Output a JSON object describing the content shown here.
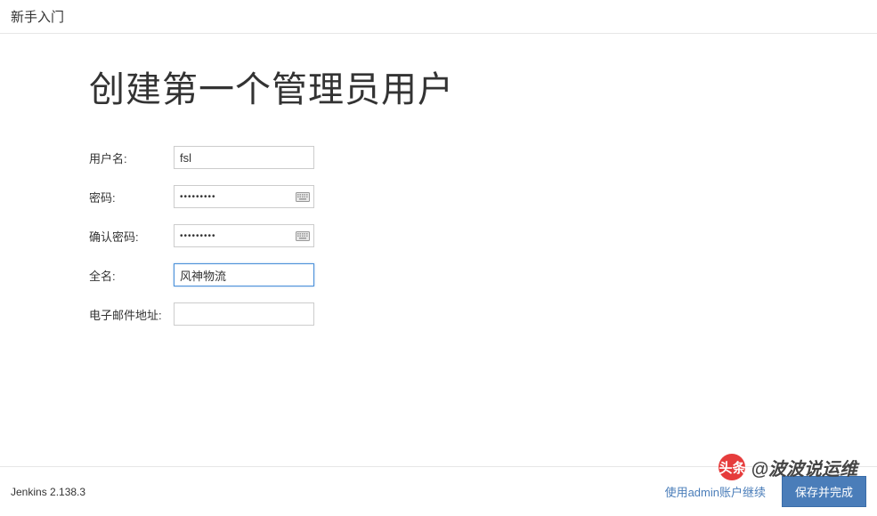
{
  "header": {
    "breadcrumb": "新手入门"
  },
  "main": {
    "title": "创建第一个管理员用户",
    "form": {
      "username": {
        "label": "用户名:",
        "value": "fsl"
      },
      "password": {
        "label": "密码:",
        "value": "•••••••••"
      },
      "confirm_password": {
        "label": "确认密码:",
        "value": "•••••••••"
      },
      "fullname": {
        "label": "全名:",
        "value": "风神物流"
      },
      "email": {
        "label": "电子邮件地址:",
        "value": ""
      }
    }
  },
  "footer": {
    "version": "Jenkins 2.138.3",
    "skip_label": "使用admin账户继续",
    "save_label": "保存并完成"
  },
  "watermark": {
    "prefix": "头条",
    "text": "@波波说运维"
  }
}
